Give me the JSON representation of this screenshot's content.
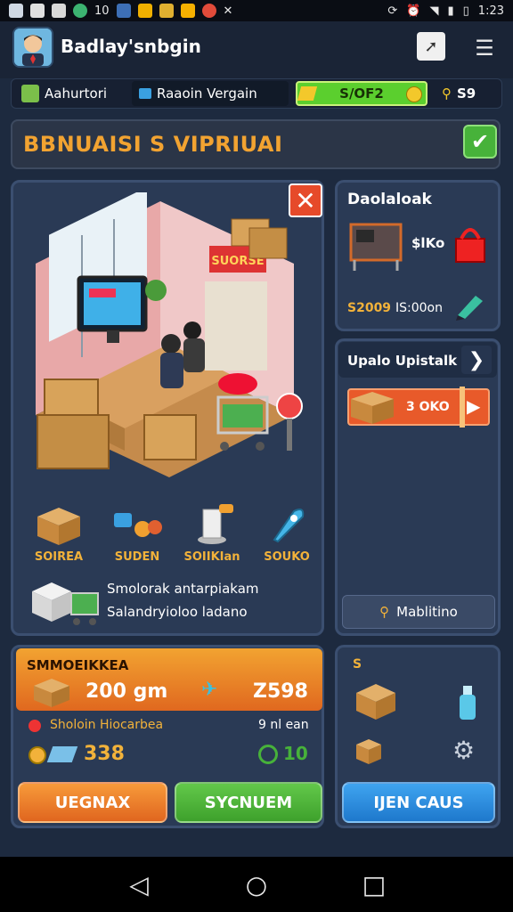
{
  "status_bar": {
    "left_time": "10",
    "clock": "1:23"
  },
  "header": {
    "title": "Badlay'snbgin"
  },
  "resources": {
    "building_label": "Aahurtori",
    "location_label": "Raaoin Vergain",
    "xp_value": "S/OF2",
    "coins_value": "S9"
  },
  "banner": {
    "title": "BBNUAISI S VIPRIUAI"
  },
  "scene": {
    "sign_text": "SUORSE",
    "items": [
      {
        "label": "SOIREA",
        "icon": "box-icon"
      },
      {
        "label": "SUDEN",
        "icon": "gems-icon"
      },
      {
        "label": "SOIIKIan",
        "icon": "cup-icon"
      },
      {
        "label": "SOUKO",
        "icon": "rocket-icon"
      }
    ],
    "desc_line1": "Smolorak antarpiakam",
    "desc_line2": "Salandryioloo ladano"
  },
  "right1": {
    "title": "Daolaloak",
    "price_label": "$lKo",
    "cost": "S2009",
    "time": "IS:00on"
  },
  "right2": {
    "title": "Upalo Upistalk",
    "slider_value": "3 OKO",
    "button_label": "Mablitino"
  },
  "orders": {
    "title": "SMMOEIKKEA",
    "amount": "200 gm",
    "score": "Z598",
    "subtitle": "Sholoin Hiocarbea",
    "right_text": "9 nl ean",
    "count": "338",
    "timer": "10"
  },
  "inventory": {
    "count": "S"
  },
  "buttons": {
    "left": "UEGNAX",
    "middle": "SYCNUEM",
    "right": "IJEN CAUS"
  },
  "colors": {
    "accent_orange": "#f2a331",
    "green": "#47b23a",
    "blue": "#2f8fe0",
    "panel": "#2a3a55"
  }
}
